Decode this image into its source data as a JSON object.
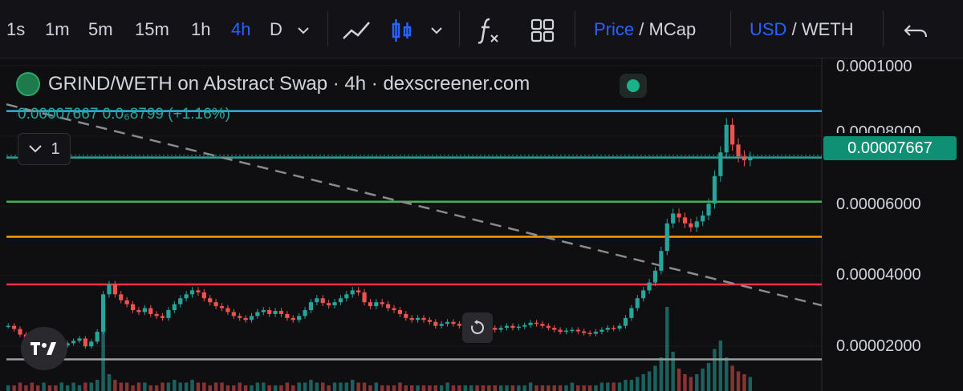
{
  "toolbar": {
    "intervals": [
      "1s",
      "1m",
      "5m",
      "15m",
      "1h",
      "4h",
      "D"
    ],
    "active_interval": "4h",
    "price_label": "Price",
    "mcap_label": "MCap",
    "usd_label": "USD",
    "weth_label": "WETH",
    "slash": "/"
  },
  "legend": {
    "title": "GRIND/WETH on Abstract Swap · 4h · dexscreener.com",
    "ohlc": "0.00007667  0.0₆8799 (+1.16%)",
    "collapse_count": "1"
  },
  "price_axis": {
    "ticks": [
      "0.0001000",
      "0.00008000",
      "0.00006000",
      "0.00004000",
      "0.00002000"
    ],
    "current_price": "0.00007667"
  },
  "colors": {
    "up": "#26a69a",
    "down": "#ef5350",
    "accent": "#2962ff",
    "cyan_line": "#29b6d8",
    "green_line": "#4caf50",
    "orange_line": "#ff9800",
    "red_line": "#ef3340",
    "gray_line": "#9e9e9e"
  },
  "chart_data": {
    "type": "candlestick",
    "symbol": "GRIND/WETH",
    "interval": "4h",
    "ylim": [
      1.3e-05,
      0.0001
    ],
    "last_price": 7.667e-05,
    "horizontal_levels": [
      {
        "value": 8.85e-05,
        "color": "cyan"
      },
      {
        "value": 7.67e-05,
        "color": "teal"
      },
      {
        "value": 6.55e-05,
        "color": "green"
      },
      {
        "value": 5.66e-05,
        "color": "orange"
      },
      {
        "value": 4.45e-05,
        "color": "red"
      },
      {
        "value": 2.55e-05,
        "color": "gray"
      }
    ],
    "trendline": {
      "start": 9.02e-05,
      "end": 3.92e-05,
      "style": "dashed"
    },
    "closes": [
      3.4e-05,
      3.32e-05,
      3.18e-05,
      3.1e-05,
      3.05e-05,
      3e-05,
      3.15e-05,
      2.92e-05,
      2.84e-05,
      2.9e-05,
      2.96e-05,
      3.02e-05,
      3.08e-05,
      2.88e-05,
      3e-05,
      3.25e-05,
      4.2e-05,
      4.45e-05,
      4.2e-05,
      4.05e-05,
      3.95e-05,
      3.8e-05,
      3.75e-05,
      3.85e-05,
      3.7e-05,
      3.65e-05,
      3.6e-05,
      3.8e-05,
      3.95e-05,
      4.1e-05,
      4.2e-05,
      4.3e-05,
      4.25e-05,
      4.1e-05,
      4e-05,
      3.9e-05,
      3.85e-05,
      3.75e-05,
      3.65e-05,
      3.6e-05,
      3.55e-05,
      3.65e-05,
      3.75e-05,
      3.8e-05,
      3.7e-05,
      3.78e-05,
      3.7e-05,
      3.6e-05,
      3.55e-05,
      3.65e-05,
      3.8e-05,
      4e-05,
      4.1e-05,
      3.98e-05,
      3.92e-05,
      4e-05,
      4.1e-05,
      4.2e-05,
      4.3e-05,
      4.25e-05,
      4e-05,
      3.9e-05,
      4e-05,
      3.95e-05,
      3.85e-05,
      3.8e-05,
      3.7e-05,
      3.6e-05,
      3.55e-05,
      3.6e-05,
      3.55e-05,
      3.5e-05,
      3.4e-05,
      3.45e-05,
      3.5e-05,
      3.45e-05,
      3.4e-05,
      3.45e-05,
      3.5e-05,
      3.45e-05,
      3.4e-05,
      3.35e-05,
      3.3e-05,
      3.35e-05,
      3.4e-05,
      3.35e-05,
      3.38e-05,
      3.42e-05,
      3.48e-05,
      3.45e-05,
      3.4e-05,
      3.35e-05,
      3.3e-05,
      3.25e-05,
      3.28e-05,
      3.3e-05,
      3.26e-05,
      3.22e-05,
      3.2e-05,
      3.25e-05,
      3.3e-05,
      3.35e-05,
      3.33e-05,
      3.4e-05,
      3.6e-05,
      3.85e-05,
      4.1e-05,
      4.3e-05,
      4.5e-05,
      4.8e-05,
      5.3e-05,
      6e-05,
      6.25e-05,
      6.15e-05,
      6e-05,
      5.9e-05,
      6.05e-05,
      6.2e-05,
      6.5e-05,
      7.2e-05,
      7.8e-05,
      8.5e-05,
      8e-05,
      7.7e-05,
      7.6e-05,
      7.67e-05
    ],
    "volumes": [
      2,
      2,
      3,
      2,
      3,
      2,
      3,
      2,
      2,
      3,
      2,
      3,
      2,
      3,
      3,
      4,
      24,
      6,
      4,
      3,
      3,
      2,
      3,
      3,
      2,
      2,
      3,
      3,
      4,
      3,
      3,
      4,
      3,
      3,
      2,
      3,
      3,
      2,
      2,
      3,
      2,
      2,
      3,
      3,
      2,
      2,
      2,
      3,
      2,
      3,
      3,
      4,
      3,
      3,
      2,
      3,
      3,
      3,
      4,
      3,
      3,
      2,
      3,
      2,
      2,
      2,
      3,
      2,
      2,
      2,
      2,
      2,
      2,
      2,
      3,
      2,
      2,
      2,
      2,
      2,
      2,
      2,
      2,
      2,
      2,
      2,
      2,
      2,
      3,
      2,
      2,
      2,
      2,
      2,
      2,
      3,
      2,
      2,
      2,
      2,
      3,
      3,
      3,
      3,
      4,
      4,
      5,
      6,
      7,
      9,
      12,
      30,
      14,
      8,
      6,
      5,
      6,
      8,
      10,
      15,
      18,
      12,
      9,
      7,
      6,
      5
    ]
  }
}
